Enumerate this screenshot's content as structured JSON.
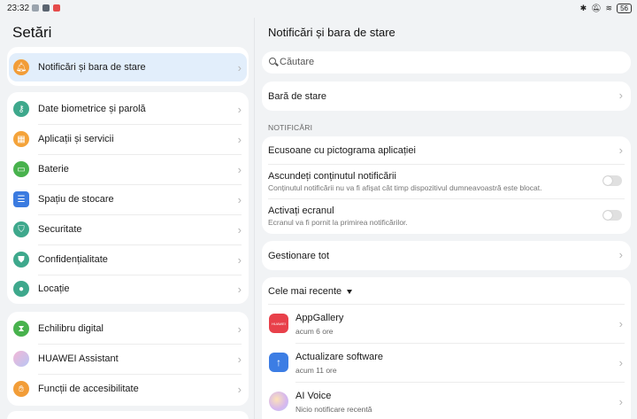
{
  "status_bar": {
    "time": "23:32",
    "battery": "56",
    "left_icon_colors": [
      "#9aa3ad",
      "#5b6470",
      "#e54b4b"
    ]
  },
  "left": {
    "title": "Setări",
    "selected_item": {
      "label": "Notificări și bara de stare",
      "icon": "bell-icon",
      "color": "#f29d38"
    },
    "group1": [
      {
        "label": "Date biometrice și parolă",
        "icon": "key-icon",
        "color": "#3ea88c"
      },
      {
        "label": "Aplicații și servicii",
        "icon": "apps-icon",
        "color": "#f4a33a"
      },
      {
        "label": "Baterie",
        "icon": "battery-icon",
        "color": "#48b24d"
      },
      {
        "label": "Spațiu de stocare",
        "icon": "storage-icon",
        "color": "#3b7be0"
      },
      {
        "label": "Securitate",
        "icon": "shield-icon",
        "color": "#3ea88c"
      },
      {
        "label": "Confidențialitate",
        "icon": "privacy-icon",
        "color": "#3ea88c"
      },
      {
        "label": "Locație",
        "icon": "location-icon",
        "color": "#3ea88c"
      }
    ],
    "group2": [
      {
        "label": "Echilibru digital",
        "icon": "hourglass-icon",
        "color": "#48b24d"
      },
      {
        "label": "HUAWEI Assistant",
        "icon": "assistant-icon",
        "color": "#c9a6e8"
      },
      {
        "label": "Funcții de accesibilitate",
        "icon": "hand-icon",
        "color": "#f29d38"
      }
    ]
  },
  "right": {
    "title": "Notificări și bara de stare",
    "search_placeholder": "Căutare",
    "status_bar_row": "Bară de stare",
    "section_notifications": "NOTIFICĂRI",
    "badges_row": "Ecusoane cu pictograma aplicației",
    "hide_content": {
      "title": "Ascundeți conținutul notificării",
      "subtitle": "Conținutul notificării nu va fi afișat cât timp dispozitivul dumneavoastră este blocat.",
      "enabled": false
    },
    "wake_screen": {
      "title": "Activați ecranul",
      "subtitle": "Ecranul va fi pornit la primirea notificărilor.",
      "enabled": false
    },
    "manage_all": "Gestionare tot",
    "recent_dropdown": "Cele mai recente",
    "apps": [
      {
        "name": "AppGallery",
        "time": "acum 6 ore",
        "icon": "appgallery-icon",
        "color": "#e8404a",
        "icon_text": "HUAWEI"
      },
      {
        "name": "Actualizare software",
        "time": "acum 11 ore",
        "icon": "update-icon",
        "color": "#3c7de4",
        "icon_text": "↑"
      },
      {
        "name": "AI Voice",
        "time": "Nicio notificare recentă",
        "icon": "ai-voice-icon",
        "color": "#d6b7ef",
        "icon_text": ""
      }
    ]
  }
}
